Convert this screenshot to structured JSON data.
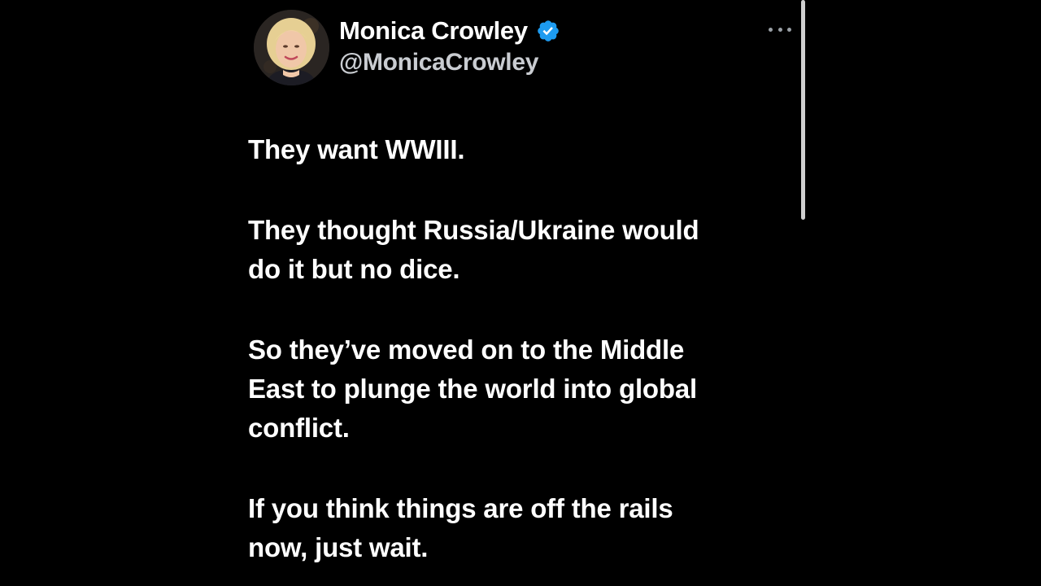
{
  "author": {
    "display_name": "Monica Crowley",
    "handle": "@MonicaCrowley",
    "verified_icon": "verified-badge-icon",
    "avatar_icon": "profile-photo"
  },
  "menu": {
    "icon": "more-horizontal-icon"
  },
  "tweet": {
    "paragraphs": [
      "They want WWIII.",
      "They thought Russia/Ukraine would\ndo it but no dice.",
      "So they’ve moved on to the Middle\nEast to plunge the world into global\nconflict.",
      "If you think things are off the rails\nnow, just wait."
    ]
  },
  "colors": {
    "background": "#000000",
    "text": "#ffffff",
    "handle": "#c9ccd1",
    "verified": "#1d9bf0",
    "scrollbar": "#d0d0d0"
  }
}
